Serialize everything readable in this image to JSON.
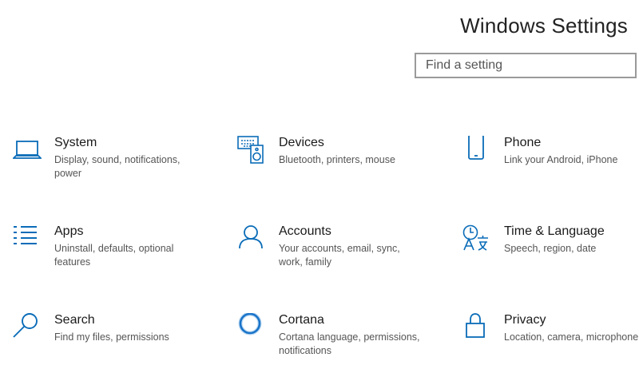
{
  "window": {
    "title": "Windows Settings"
  },
  "search": {
    "placeholder": "Find a setting"
  },
  "tiles": [
    {
      "name": "System",
      "desc": "Display, sound, notifications, power",
      "icon": "laptop-icon"
    },
    {
      "name": "Devices",
      "desc": "Bluetooth, printers, mouse",
      "icon": "keyboard-speaker-icon"
    },
    {
      "name": "Phone",
      "desc": "Link your Android, iPhone",
      "icon": "phone-icon"
    },
    {
      "name": "Apps",
      "desc": "Uninstall, defaults, optional features",
      "icon": "list-icon"
    },
    {
      "name": "Accounts",
      "desc": "Your accounts, email, sync, work, family",
      "icon": "person-icon"
    },
    {
      "name": "Time & Language",
      "desc": "Speech, region, date",
      "icon": "clock-language-icon"
    },
    {
      "name": "Search",
      "desc": "Find my files, permissions",
      "icon": "magnifier-icon"
    },
    {
      "name": "Cortana",
      "desc": "Cortana language, permissions, notifications",
      "icon": "cortana-ring-icon"
    },
    {
      "name": "Privacy",
      "desc": "Location, camera, microphone",
      "icon": "padlock-icon"
    }
  ],
  "colors": {
    "accent": "#0a6cb8",
    "cortana": "#1b74c9"
  }
}
